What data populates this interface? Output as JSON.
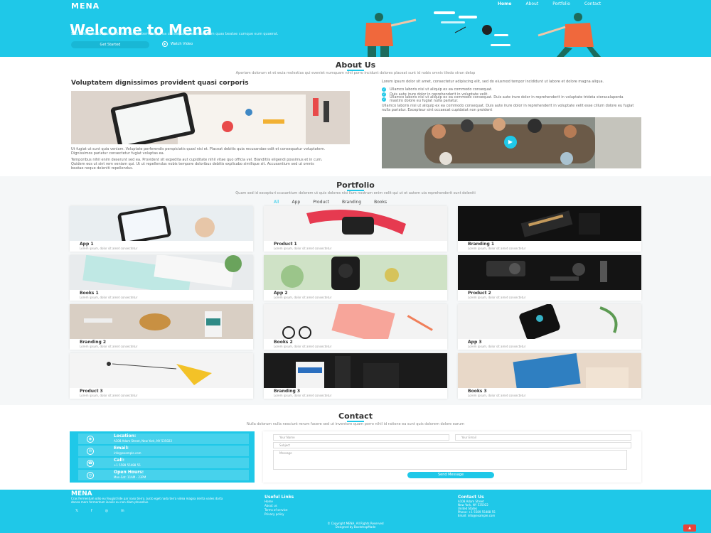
{
  "header": {
    "brand": "MENA",
    "nav": [
      "Home",
      "About",
      "Portfolio",
      "Contact"
    ]
  },
  "hero": {
    "title": "Welcome to Mena",
    "subtitle": "Sed autem laudantium dolores. Voluptatem itaque ea consequatur eveniet. Eum quas beatae cumque eum quaerat.",
    "primary_button": "Get Started",
    "video_button": "Watch Video"
  },
  "about": {
    "title": "About Us",
    "subtitle": "Aperiam dolorum et et wuia molestias qui eveniet numquam nihil porro incidunt dolores placeat sunt id nobis omnis tiledo stran delop",
    "heading": "Voluptatem dignissimos provident quasi corporis",
    "para1": "Ut fugiat ut sunt quia veniam. Voluptate perferendis perspiciatis quod nisi et. Placeat debitis quia recusandae odit et consequatur voluptatem. Dignissimos pariatur consectetur fugiat voluptas ea.",
    "para2": "Temporibus nihil enim deserunt sed ea. Provident sit expedita aut cupiditate nihil vitae quo officia vel. Blanditiis eligendi possimus et in cum. Quidem eos ut sint rem veniam qui. Ut ut repellendus nobis tempore doloribus debitis explicabo similique sit. Accusantium sed ut omnis beatae neque deleniti repellendus.",
    "right_para": "Lorem ipsum dolor sit amet, consectetur adipiscing elit, sed do eiusmod tempor incididunt ut labore et dolore magna aliqua.",
    "checks": [
      "Ullamco laboris nisi ut aliquip ex ea commodo consequat.",
      "Duis aute irure dolor in reprehenderit in voluptate velit.",
      "Ullamco laboris nisi ut aliquip ex ea commodo consequat. Duis aute irure dolor in reprehenderit in voluptate trideta storacalaperda mastiro dolore eu fugiat nulla pariatur."
    ],
    "right_para2": "Ullamco laboris nisi ut aliquip ex ea commodo consequat. Duis aute irure dolor in reprehenderit in voluptate velit esse cillum dolore eu fugiat nulla pariatur. Excepteur sint occaecat cupidatat non proident"
  },
  "portfolio": {
    "title": "Portfolio",
    "subtitle": "Quam sed id excepturi ccusantium dolorem ut quis dolores nisi llum nostrum enim velit qui ut et autem uia reprehenderit sunt deleniti",
    "filters": [
      "All",
      "App",
      "Product",
      "Branding",
      "Books"
    ],
    "items": [
      {
        "title": "App 1",
        "desc": "Lorem ipsum, dolor sit amet consectetur"
      },
      {
        "title": "Product 1",
        "desc": "Lorem ipsum, dolor sit amet consectetur"
      },
      {
        "title": "Branding 1",
        "desc": "Lorem ipsum, dolor sit amet consectetur"
      },
      {
        "title": "Books 1",
        "desc": "Lorem ipsum, dolor sit amet consectetur"
      },
      {
        "title": "App 2",
        "desc": "Lorem ipsum, dolor sit amet consectetur"
      },
      {
        "title": "Product 2",
        "desc": "Lorem ipsum, dolor sit amet consectetur"
      },
      {
        "title": "Branding 2",
        "desc": "Lorem ipsum, dolor sit amet consectetur"
      },
      {
        "title": "Books 2",
        "desc": "Lorem ipsum, dolor sit amet consectetur"
      },
      {
        "title": "App 3",
        "desc": "Lorem ipsum, dolor sit amet consectetur"
      },
      {
        "title": "Product 3",
        "desc": "Lorem ipsum, dolor sit amet consectetur"
      },
      {
        "title": "Branding 3",
        "desc": "Lorem ipsum, dolor sit amet consectetur"
      },
      {
        "title": "Books 3",
        "desc": "Lorem ipsum, dolor sit amet consectetur"
      }
    ]
  },
  "contact": {
    "title": "Contact",
    "subtitle": "Nulla dolorum nulla nesciunt rerum facere sed ut inventore quam porro nihil id ratione ea sunt quis dolorem dolore earum",
    "info": [
      {
        "label": "Location:",
        "value": "A108 Adam Street, New York, NY 535022",
        "icon": "location-icon"
      },
      {
        "label": "Email:",
        "value": "info@example.com",
        "icon": "email-icon"
      },
      {
        "label": "Call:",
        "value": "+1 5589 55488 55",
        "icon": "phone-icon"
      },
      {
        "label": "Open Hours:",
        "value": "Mon-Sat: 11AM - 23PM",
        "icon": "clock-icon"
      }
    ],
    "form": {
      "name_placeholder": "Your Name",
      "email_placeholder": "Your Email",
      "subject_placeholder": "Subject",
      "message_placeholder": "Message",
      "send_label": "Send Message"
    }
  },
  "footer": {
    "brand": "MENA",
    "desc": "Cras fermentum odio eu feugiat lide par naso tierra. Justo eget nada terra videa magna derita valies darta donna mare fermentum iaculis eu non diam phasellus.",
    "social": [
      "twitter-icon",
      "facebook-icon",
      "instagram-icon",
      "linkedin-icon"
    ],
    "links_title": "Useful Links",
    "links": [
      "Home",
      "About us",
      "Terms of service",
      "Privacy policy"
    ],
    "contact_title": "Contact Us",
    "contact_lines": [
      "A108 Adam Street",
      "New York, NY 535022",
      "United States"
    ],
    "phone": "Phone: +1 5589 55488 55",
    "email": "Email: info@example.com",
    "copyright": "© Copyright MENA. All Rights Reserved",
    "credit": "Designed by BootstrapMade"
  },
  "colors": {
    "accent": "#1fc8e8",
    "back_to_top": "#e8443a"
  }
}
